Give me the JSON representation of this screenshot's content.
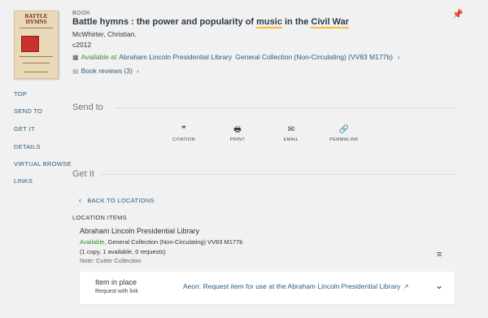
{
  "record": {
    "type": "BOOK",
    "title_parts": [
      "Battle hymns : the power and popularity of ",
      "music",
      " in the ",
      "Civil War"
    ],
    "author": "McWhirter, Christian.",
    "date": "c2012",
    "availability": {
      "status": "Available at",
      "library": "Abraham Lincoln Presidential Library",
      "collection": "General Collection (Non-Circulating) (VV83 M177b)"
    },
    "reviews": "Book reviews (3)",
    "cover_text": "BATTLE HYMNS"
  },
  "nav": [
    "TOP",
    "SEND TO",
    "GET IT",
    "DETAILS",
    "VIRTUAL BROWSE",
    "LINKS"
  ],
  "send_to": {
    "heading": "Send to",
    "buttons": [
      {
        "icon": "quote-icon",
        "glyph": "❞",
        "label": "CITATION"
      },
      {
        "icon": "print-icon",
        "glyph": "🖶",
        "label": "PRINT"
      },
      {
        "icon": "email-icon",
        "glyph": "✉",
        "label": "EMAIL"
      },
      {
        "icon": "link-icon",
        "glyph": "🔗",
        "label": "PERMALINK"
      }
    ]
  },
  "get_it": {
    "heading": "Get It",
    "back_label": "BACK TO LOCATIONS",
    "location_items_label": "LOCATION ITEMS",
    "library": "Abraham Lincoln Presidential Library",
    "status": "Available",
    "collection_line": ", General Collection (Non-Circulating) VV83 M177b",
    "copies": "(1 copy, 1 available, 0 requests)",
    "note": "Note:  Cutter Collection",
    "request": {
      "title": "Item in place",
      "subtitle": "Request with link",
      "link": "Aeon: Request item for use at the Abraham Lincoln Presidential Library"
    }
  },
  "colors": {
    "background": "#f1f1f1",
    "available": "#3a8f2e",
    "link": "#2c5a7a",
    "highlight": "#f4c230"
  }
}
